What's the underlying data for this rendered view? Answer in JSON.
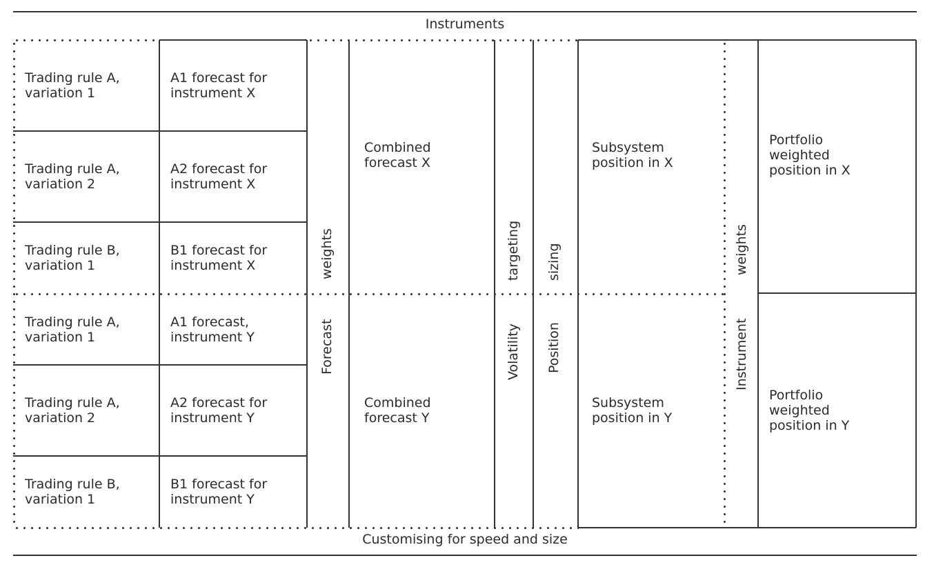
{
  "header": {
    "title": "Instruments"
  },
  "footer": {
    "title": "Customising for speed and size"
  },
  "trading_rules": [
    {
      "rule": "Trading rule A,\nvariation 1",
      "forecast": "A1 forecast for\ninstrument X"
    },
    {
      "rule": "Trading rule A,\nvariation 2",
      "forecast": "A2 forecast for\ninstrument X"
    },
    {
      "rule": "Trading rule B,\nvariation 1",
      "forecast": "B1 forecast for\ninstrument X"
    },
    {
      "rule": "Trading rule A,\nvariation 1",
      "forecast": "A1 forecast,\ninstrument Y"
    },
    {
      "rule": "Trading rule A,\nvariation 2",
      "forecast": "A2 forecast for\ninstrument Y"
    },
    {
      "rule": "Trading rule B,\nvariation 1",
      "forecast": "B1 forecast for\ninstrument Y"
    }
  ],
  "stages": {
    "forecast_weights": {
      "line1": "Forecast",
      "line2": "weights"
    },
    "volatility_targeting": {
      "line1": "Volatility",
      "line2": "targeting"
    },
    "position_sizing": {
      "line1": "Position",
      "line2": "sizing"
    },
    "instrument_weights": {
      "line1": "Instrument",
      "line2": "weights"
    }
  },
  "combined": [
    "Combined\nforecast X",
    "Combined\nforecast Y"
  ],
  "subsystem": [
    "Subsystem\nposition in X",
    "Subsystem\nposition in Y"
  ],
  "portfolio": [
    "Portfolio\nweighted\nposition in X",
    "Portfolio\nweighted\nposition in Y"
  ]
}
